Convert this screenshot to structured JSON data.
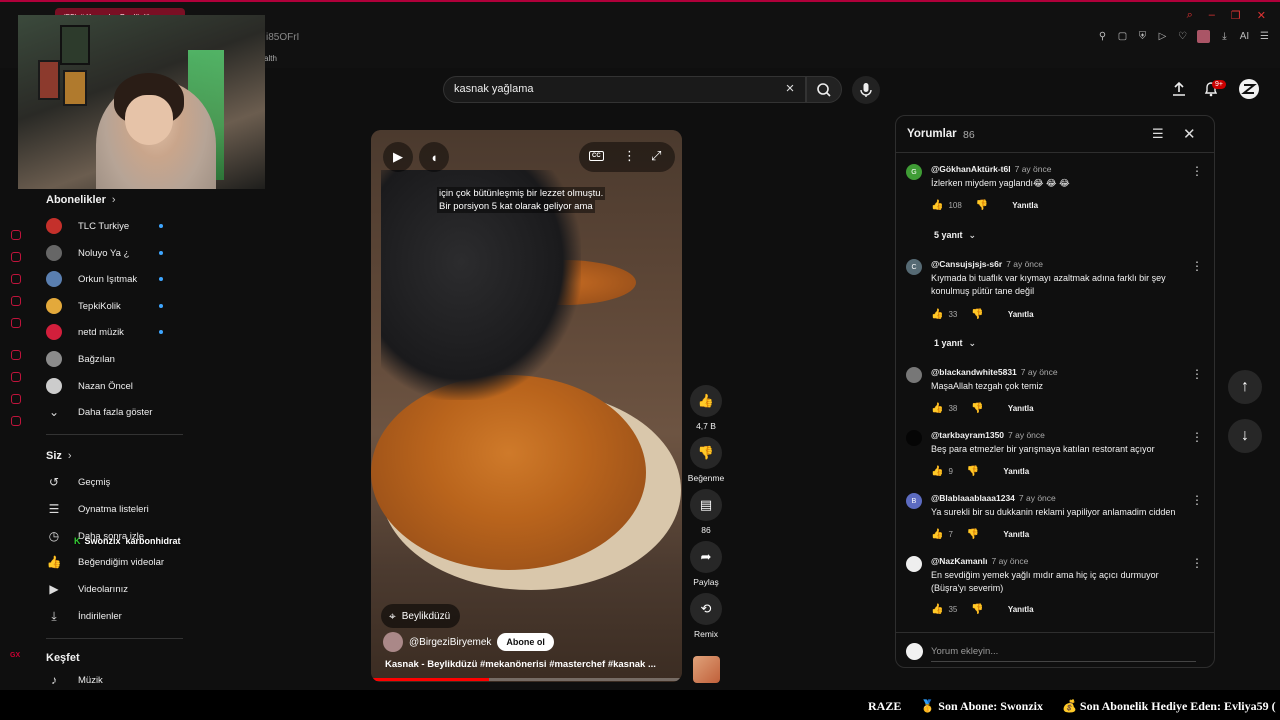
{
  "browser": {
    "tab_title": "(55) # Kasnak - Beylikdü...",
    "url_fragment": "i85OFrI",
    "bookmark_fragment": "alth"
  },
  "sidebar": {
    "subscriptions_title": "Abonelikler",
    "subscriptions": [
      {
        "label": "TLC Turkiye",
        "color": "#c4302b",
        "new": true
      },
      {
        "label": "Noluyo Ya ¿",
        "color": "#666666",
        "new": true
      },
      {
        "label": "Orkun Işıtmak",
        "color": "#5a7fb0",
        "new": true
      },
      {
        "label": "TepkiKolik",
        "color": "#e3a93b",
        "new": true
      },
      {
        "label": "netd müzik",
        "color": "#d21f3c",
        "new": true
      },
      {
        "label": "Bağzılan",
        "color": "#8b8b8b",
        "new": false
      },
      {
        "label": "Nazan Öncel",
        "color": "#cccccc",
        "new": false
      }
    ],
    "show_more": "Daha fazla göster",
    "you_title": "Siz",
    "you_items": [
      {
        "label": "Geçmiş",
        "icon": "history-icon"
      },
      {
        "label": "Oynatma listeleri",
        "icon": "playlist-icon"
      },
      {
        "label": "Daha sonra izle",
        "icon": "clock-icon"
      },
      {
        "label": "Beğendiğim videolar",
        "icon": "thumb-up-icon"
      },
      {
        "label": "Videolarınız",
        "icon": "video-icon"
      },
      {
        "label": "İndirilenler",
        "icon": "download-icon"
      }
    ],
    "explore_title": "Keşfet",
    "explore_items": [
      {
        "label": "Müzik",
        "icon": "music-icon"
      }
    ],
    "overlay_name": "Swonzix",
    "overlay_text": "karbonhidrat"
  },
  "search": {
    "value": "kasnak yağlama"
  },
  "notifications": {
    "badge": "9+"
  },
  "video": {
    "caption_line1": "için çok bütünleşmiş bir lezzet olmuştu.",
    "caption_line2": "Bir porsiyon 5 kat olarak geliyor ama",
    "cc_label": "CC",
    "location": "Beylikdüzü",
    "channel": "@BirgeziBiryemek",
    "subscribe_label": "Abone ol",
    "title": "Kasnak - Beylikdüzü #mekanönerisi #masterchef #kasnak ...",
    "progress": 0.38
  },
  "actions": {
    "like_count": "4,7 B",
    "dislike_label": "Beğenme",
    "comment_count": "86",
    "share_label": "Paylaş",
    "remix_label": "Remix"
  },
  "comments": {
    "title": "Yorumlar",
    "count": "86",
    "input_placeholder": "Yorum ekleyin...",
    "reply_label": "Yanıtla",
    "items": [
      {
        "author": "@GökhanAktürk-t6l",
        "time": "7 ay önce",
        "text": "İzlerken miydem yaglandı😂 😂 😂",
        "likes": "108",
        "avatar_letter": "G",
        "avatar_color": "#3f9c35"
      },
      {
        "author": "@Cansujsjsjs-s6r",
        "time": "7 ay önce",
        "text": "Kıymada bi tuaflık var kıymayı azaltmak adına farklı bir şey konulmuş pütür tane değil",
        "likes": "33",
        "avatar_letter": "C",
        "avatar_color": "#566a74"
      },
      {
        "author": "@blackandwhite5831",
        "time": "7 ay önce",
        "text": "MaşaAllah tezgah çok temiz",
        "likes": "38",
        "avatar_letter": "",
        "avatar_color": "#777777"
      },
      {
        "author": "@tarkbayram1350",
        "time": "7 ay önce",
        "text": "Beş para etmezler bir yarışmaya katılan restorant açıyor",
        "likes": "9",
        "avatar_letter": "",
        "avatar_color": "#050505"
      },
      {
        "author": "@Blablaaablaaa1234",
        "time": "7 ay önce",
        "text": "Ya surekli bir su dukkanin reklami yapiliyor anlamadim cidden",
        "likes": "7",
        "avatar_letter": "B",
        "avatar_color": "#5c6bc0"
      },
      {
        "author": "@NazKamanlı",
        "time": "7 ay önce",
        "text": "En sevdiğim yemek yağlı mıdır ama hiç iç açıcı durmuyor (Büşra'yı severim)",
        "likes": "35",
        "avatar_letter": "",
        "avatar_color": "#eeeeee"
      }
    ],
    "replies": [
      {
        "label": "5 yanıt"
      },
      {
        "label": "1 yanıt"
      }
    ]
  },
  "ticker": {
    "text1": "RAZE",
    "text2": "🥇 Son Abone: Swonzix",
    "text3": "💰 Son Abonelik Hediye Eden: Evliya59 (",
    "left_tag": "GX"
  }
}
